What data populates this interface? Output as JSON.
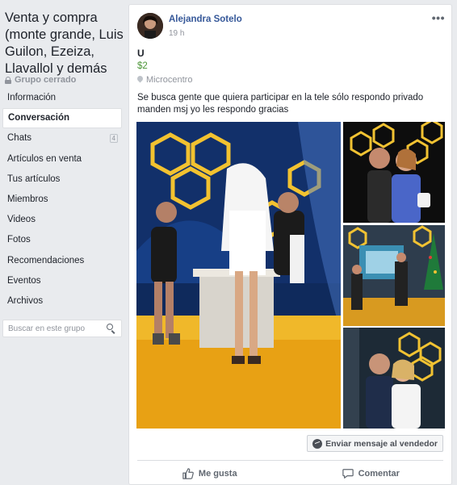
{
  "group": {
    "title": "Venta y compra (monte grande, Luis Guilon, Ezeiza, Llavallol y demás",
    "type": "Grupo cerrado",
    "search_placeholder": "Buscar en este grupo"
  },
  "nav": [
    {
      "label": "Información",
      "badge": ""
    },
    {
      "label": "Conversación",
      "badge": ""
    },
    {
      "label": "Chats",
      "badge": "4"
    },
    {
      "label": "Artículos en venta",
      "badge": ""
    },
    {
      "label": "Tus artículos",
      "badge": ""
    },
    {
      "label": "Miembros",
      "badge": ""
    },
    {
      "label": "Videos",
      "badge": ""
    },
    {
      "label": "Fotos",
      "badge": ""
    },
    {
      "label": "Recomendaciones",
      "badge": ""
    },
    {
      "label": "Eventos",
      "badge": ""
    },
    {
      "label": "Archivos",
      "badge": ""
    }
  ],
  "post": {
    "author": "Alejandra Sotelo",
    "time": "19 h",
    "more": "•••",
    "title": "U",
    "price": "$2",
    "location": "Microcentro",
    "description": "Se busca gente que quiera participar en la tele sólo respondo privado manden msj yo les respondo gracias",
    "message_button": "Enviar mensaje al vendedor",
    "like_label": "Me gusta",
    "comment_label": "Comentar"
  },
  "colors": {
    "link": "#365899",
    "price": "#4b9537",
    "background": "#e9ebee"
  }
}
